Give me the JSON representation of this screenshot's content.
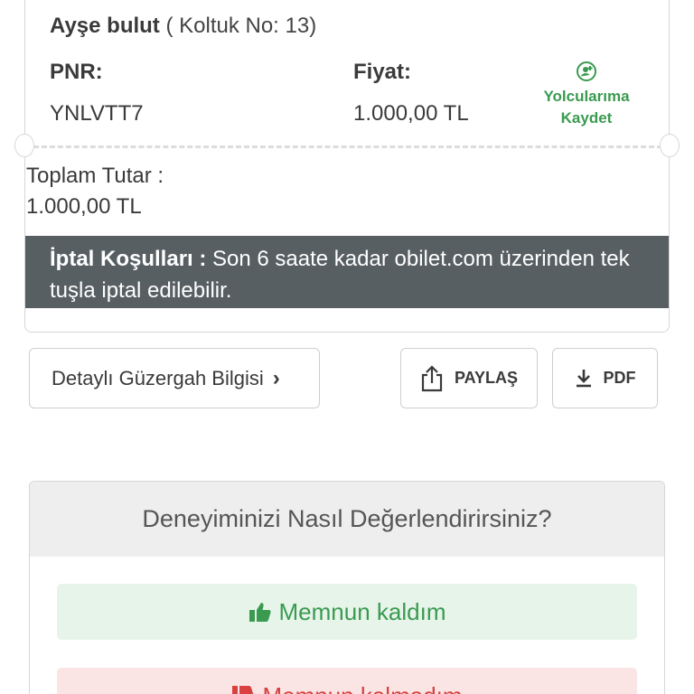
{
  "ticket": {
    "passenger_name": "Ayşe bulut",
    "seat_text": "( Koltuk No: 13)",
    "pnr_label": "PNR:",
    "pnr_value": "YNLVTT7",
    "price_label": "Fiyat:",
    "price_value": "1.000,00 TL",
    "save_line1": "Yolcularıma",
    "save_line2": "Kaydet",
    "total_label": "Toplam Tutar :",
    "total_value": "1.000,00 TL",
    "cancel_title": "İptal Koşulları :",
    "cancel_text": " Son 6 saate kadar obilet.com üzerinden tek tuşla iptal edilebilir."
  },
  "actions": {
    "route_label": "Detaylı Güzergah Bilgisi",
    "share_label": "PAYLAŞ",
    "pdf_label": "PDF"
  },
  "rating": {
    "title": "Deneyiminizi Nasıl Değerlendirirsiniz?",
    "positive": "Memnun kaldım",
    "negative": "Memnun kalmadım"
  },
  "colors": {
    "green": "#3a9a50",
    "red": "#d94040",
    "dark_bar": "#585f62"
  }
}
